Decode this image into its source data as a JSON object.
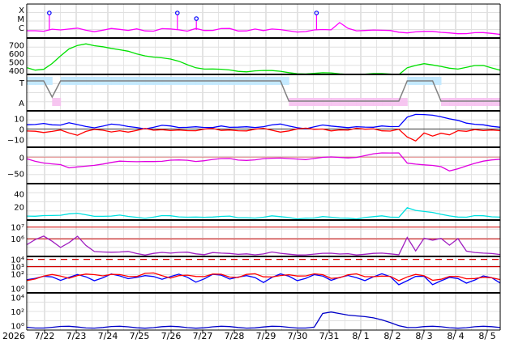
{
  "chart_data": {
    "type": "line",
    "x_axis": {
      "year_label": "2026",
      "tick_labels": [
        "7/22",
        "7/23",
        "7/24",
        "7/25",
        "7/26",
        "7/27",
        "7/28",
        "7/29",
        "7/30",
        "7/31",
        "8/ 1",
        "8/ 2",
        "8/ 3",
        "8/ 4",
        "8/ 5"
      ],
      "range": [
        "7/21 18:00",
        "8/ 5 12:00"
      ]
    },
    "panels": [
      {
        "id": "xray",
        "y_tick_labels": [
          "X",
          "M",
          "C"
        ],
        "right_label": "",
        "series": [
          {
            "color": "#ff00ff",
            "values": [
              1.0,
              1.1,
              1.05,
              1.2,
              1.0,
              1.1,
              1.3,
              1.15,
              1.0,
              1.1,
              1.2,
              1.05,
              1.0,
              1.3,
              1.1,
              1.0,
              1.2,
              1.1,
              1.05,
              1.0,
              1.4,
              1.1,
              1.0,
              1.15,
              1.2,
              1.0,
              1.1,
              1.3,
              1.0,
              1.1,
              1.05,
              1.0,
              0.95,
              1.0,
              1.1,
              1.05,
              1.0,
              2.0,
              1.4,
              1.1,
              1.05,
              1.0,
              0.95,
              1.0,
              0.9,
              0.85,
              0.9,
              0.85,
              0.8,
              0.75,
              0.8,
              0.75,
              0.7,
              0.7,
              0.65,
              0.6,
              0.6
            ]
          }
        ],
        "events": [
          {
            "t": 0.15,
            "level": "X"
          },
          {
            "t": 4.2,
            "level": "X"
          },
          {
            "t": 4.8,
            "level": "M"
          },
          {
            "t": 8.6,
            "level": "X"
          }
        ]
      },
      {
        "id": "solar-wind-speed",
        "y_tick_labels": [
          "400",
          "500",
          "600",
          "700"
        ],
        "y_range": [
          350,
          780
        ],
        "right_label": "",
        "series": [
          {
            "color": "#00e000",
            "values": [
              430,
              410,
              420,
              480,
              560,
              640,
              690,
              720,
              700,
              680,
              650,
              630,
              620,
              600,
              580,
              560,
              540,
              520,
              500,
              470,
              440,
              420,
              410,
              400,
              395,
              390,
              392,
              400,
              395,
              385,
              378,
              372,
              368,
              365,
              362,
              360,
              358,
              356,
              360,
              358,
              355,
              352,
              350,
              352,
              355,
              440,
              460,
              470,
              450,
              440,
              430,
              425,
              440,
              450,
              445,
              420,
              405
            ]
          }
        ]
      },
      {
        "id": "imf-sector",
        "y_tick_labels": [
          "T",
          "A"
        ],
        "right_label": "",
        "series": [
          {
            "color": "#808080",
            "values": [
              1,
              1,
              1,
              0.2,
              1,
              1,
              1,
              1,
              1,
              1,
              1,
              1,
              1,
              1,
              1,
              1,
              1,
              1,
              1,
              1,
              1,
              1,
              1,
              1,
              1,
              1,
              1,
              1,
              1,
              1,
              1,
              0,
              0,
              0,
              0,
              0,
              0,
              0,
              0,
              0,
              0,
              0,
              0,
              0,
              0,
              1,
              1,
              1,
              1,
              0,
              0,
              0,
              0,
              0,
              0,
              0,
              0
            ]
          }
        ]
      },
      {
        "id": "imf-components",
        "y_tick_labels": [
          "10",
          "0",
          "−10"
        ],
        "y_range": [
          -17,
          17
        ],
        "right_label": "",
        "series": [
          {
            "color": "#0000ff",
            "values": [
              4,
              5,
              6,
              4,
              3,
              5,
              4,
              3,
              2,
              3,
              4,
              3,
              2,
              2,
              1,
              2,
              3,
              2,
              1,
              2,
              3,
              2,
              1,
              2,
              1,
              2,
              3,
              2,
              2,
              3,
              4,
              3,
              2,
              1,
              2,
              3,
              2,
              2,
              2,
              3,
              2,
              1,
              2,
              2,
              3,
              12,
              14,
              13,
              12,
              11,
              10,
              9,
              6,
              4,
              3,
              2,
              2
            ]
          },
          {
            "color": "#ff0000",
            "values": [
              -1,
              -2,
              -4,
              -3,
              -1,
              -3,
              -5,
              -2,
              -1,
              -2,
              -3,
              -1,
              -2,
              -1,
              0,
              -2,
              -1,
              -1,
              0,
              -1,
              -2,
              -1,
              0,
              -1,
              0,
              -1,
              -2,
              -1,
              0,
              -1,
              -2,
              -1,
              0,
              0,
              -1,
              0,
              -1,
              0,
              -1,
              0,
              -1,
              0,
              -1,
              -1,
              0,
              -8,
              -12,
              -4,
              -6,
              -3,
              -5,
              -2,
              -3,
              -1,
              -1,
              0,
              -1
            ]
          }
        ]
      },
      {
        "id": "dst",
        "y_tick_labels": [
          "0",
          "−50"
        ],
        "y_range": [
          -80,
          30
        ],
        "right_label": "",
        "series": [
          {
            "color": "#e000e0",
            "values": [
              -5,
              -10,
              -15,
              -20,
              -25,
              -35,
              -30,
              -25,
              -22,
              -20,
              -18,
              -15,
              -14,
              -12,
              -10,
              -12,
              -14,
              -12,
              -10,
              -8,
              -10,
              -9,
              -8,
              -7,
              -6,
              -8,
              -7,
              -6,
              -5,
              -6,
              -5,
              -4,
              -3,
              -5,
              -4,
              -3,
              -2,
              -1,
              0,
              2,
              5,
              8,
              10,
              12,
              15,
              -15,
              -20,
              -25,
              -28,
              -30,
              -40,
              -32,
              -25,
              -20,
              -15,
              -10,
              -5
            ]
          }
        ]
      },
      {
        "id": "density",
        "y_tick_labels": [
          "20",
          "40"
        ],
        "y_range": [
          0,
          55
        ],
        "right_label": "",
        "series": [
          {
            "color": "#00e0e0",
            "values": [
              6,
              7,
              8,
              7,
              6,
              8,
              10,
              9,
              7,
              6,
              5,
              6,
              5,
              5,
              4,
              5,
              6,
              5,
              4,
              5,
              6,
              5,
              4,
              4,
              5,
              4,
              5,
              4,
              4,
              5,
              4,
              4,
              3,
              4,
              3,
              4,
              3,
              3,
              4,
              3,
              4,
              4,
              5,
              4,
              5,
              20,
              15,
              12,
              10,
              8,
              7,
              6,
              5,
              6,
              5,
              4,
              5
            ]
          }
        ]
      },
      {
        "id": "electron-flux",
        "y_tick_labels": [
          "10⁶",
          "10⁷"
        ],
        "y_range": [
          4.5,
          7.6
        ],
        "right_label": "",
        "series": [
          {
            "color": "#a020c0",
            "values": [
              5.5,
              6.0,
              6.3,
              5.8,
              5.2,
              5.6,
              6.2,
              5.5,
              5.0,
              4.9,
              4.8,
              4.8,
              4.9,
              4.8,
              4.7,
              4.8,
              4.8,
              4.7,
              4.8,
              4.9,
              4.8,
              4.7,
              4.8,
              4.7,
              4.7,
              4.7,
              4.8,
              4.7,
              4.7,
              4.8,
              4.7,
              4.7,
              4.7,
              4.7,
              4.7,
              4.7,
              4.7,
              4.7,
              4.8,
              4.7,
              4.7,
              4.7,
              4.7,
              4.7,
              4.7,
              6.2,
              5.0,
              6.0,
              5.8,
              6.0,
              5.5,
              6.1,
              5.0,
              4.8,
              4.7,
              4.7,
              4.7
            ]
          }
        ]
      },
      {
        "id": "proton-flux",
        "y_tick_labels": [
          "10⁰",
          "10²",
          "10³",
          "10⁴"
        ],
        "y_range": [
          -0.6,
          4.4
        ],
        "right_label": "",
        "series": [
          {
            "color": "#0000ff",
            "values": [
              1.2,
              1.5,
              1.8,
              1.6,
              1.0,
              1.4,
              1.9,
              1.7,
              1.2,
              1.5,
              1.9,
              1.6,
              1.3,
              1.6,
              1.9,
              1.7,
              1.2,
              1.5,
              1.9,
              1.6,
              1.0,
              1.4,
              1.9,
              1.7,
              1.2,
              1.6,
              1.9,
              1.6,
              0.8,
              1.4,
              1.9,
              1.7,
              1.2,
              1.5,
              1.9,
              1.6,
              1.0,
              1.5,
              1.9,
              1.6,
              1.1,
              1.5,
              1.9,
              1.6,
              0.6,
              1.2,
              1.7,
              1.6,
              0.4,
              1.0,
              1.6,
              1.5,
              0.8,
              1.1,
              1.6,
              1.4,
              0.8
            ]
          },
          {
            "color": "#ff0000",
            "values": [
              1.2,
              1.3,
              1.6,
              1.8,
              1.7,
              1.5,
              1.9,
              2.0,
              1.8,
              1.6,
              1.9,
              2.0,
              1.8,
              1.7,
              2.0,
              2.0,
              1.7,
              1.5,
              1.9,
              1.9,
              1.6,
              1.5,
              1.9,
              2.0,
              1.7,
              1.6,
              1.9,
              1.9,
              1.5,
              1.6,
              1.9,
              2.0,
              1.7,
              1.6,
              1.9,
              1.9,
              1.5,
              1.6,
              1.9,
              1.9,
              1.5,
              1.6,
              1.8,
              1.8,
              1.1,
              1.5,
              1.8,
              1.7,
              1.2,
              1.4,
              1.7,
              1.6,
              1.2,
              1.3,
              1.6,
              1.6,
              1.3
            ]
          }
        ],
        "threshold_values": [
          4,
          3
        ]
      },
      {
        "id": "high-energy-proton",
        "y_tick_labels": [
          "10⁰",
          "10²",
          "10⁴"
        ],
        "y_range": [
          -0.6,
          4.6
        ],
        "right_label": "",
        "series": [
          {
            "color": "#0000c8",
            "values": [
              -0.2,
              -0.2,
              -0.2,
              -0.2,
              -0.2,
              -0.2,
              -0.2,
              -0.2,
              -0.2,
              -0.2,
              -0.2,
              -0.2,
              -0.2,
              -0.2,
              -0.2,
              -0.2,
              -0.2,
              -0.2,
              -0.2,
              -0.2,
              -0.2,
              -0.2,
              -0.2,
              -0.2,
              -0.2,
              -0.2,
              -0.2,
              -0.2,
              -0.2,
              -0.2,
              -0.2,
              -0.2,
              -0.2,
              -0.2,
              -0.2,
              1.6,
              1.8,
              1.7,
              1.6,
              1.5,
              1.3,
              1.0,
              0.7,
              0.4,
              0.1,
              -0.1,
              -0.2,
              -0.2,
              -0.2,
              -0.2,
              -0.2,
              -0.2,
              -0.2,
              -0.2,
              -0.2,
              -0.2,
              -0.2
            ]
          }
        ]
      }
    ]
  }
}
